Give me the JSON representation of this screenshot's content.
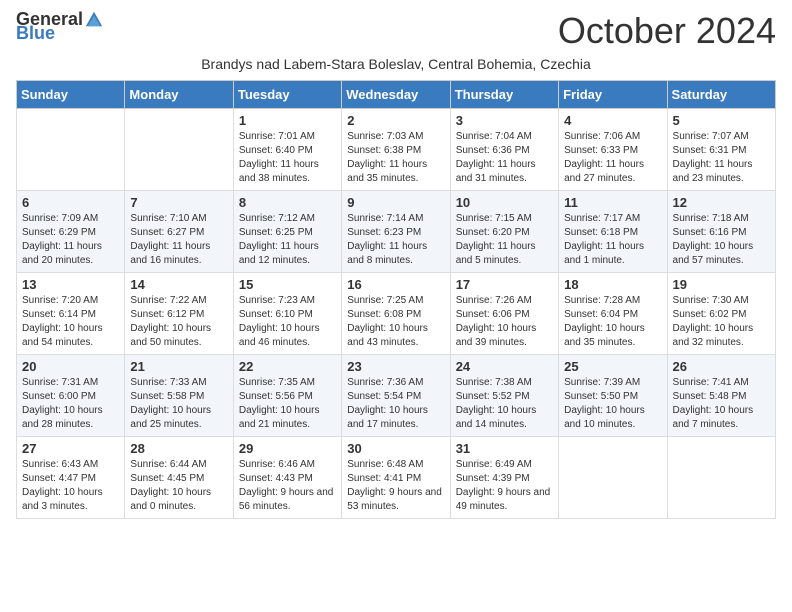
{
  "header": {
    "logo_general": "General",
    "logo_blue": "Blue",
    "month_title": "October 2024",
    "subtitle": "Brandys nad Labem-Stara Boleslav, Central Bohemia, Czechia"
  },
  "days_of_week": [
    "Sunday",
    "Monday",
    "Tuesday",
    "Wednesday",
    "Thursday",
    "Friday",
    "Saturday"
  ],
  "weeks": [
    [
      {
        "day": "",
        "info": ""
      },
      {
        "day": "",
        "info": ""
      },
      {
        "day": "1",
        "info": "Sunrise: 7:01 AM\nSunset: 6:40 PM\nDaylight: 11 hours and 38 minutes."
      },
      {
        "day": "2",
        "info": "Sunrise: 7:03 AM\nSunset: 6:38 PM\nDaylight: 11 hours and 35 minutes."
      },
      {
        "day": "3",
        "info": "Sunrise: 7:04 AM\nSunset: 6:36 PM\nDaylight: 11 hours and 31 minutes."
      },
      {
        "day": "4",
        "info": "Sunrise: 7:06 AM\nSunset: 6:33 PM\nDaylight: 11 hours and 27 minutes."
      },
      {
        "day": "5",
        "info": "Sunrise: 7:07 AM\nSunset: 6:31 PM\nDaylight: 11 hours and 23 minutes."
      }
    ],
    [
      {
        "day": "6",
        "info": "Sunrise: 7:09 AM\nSunset: 6:29 PM\nDaylight: 11 hours and 20 minutes."
      },
      {
        "day": "7",
        "info": "Sunrise: 7:10 AM\nSunset: 6:27 PM\nDaylight: 11 hours and 16 minutes."
      },
      {
        "day": "8",
        "info": "Sunrise: 7:12 AM\nSunset: 6:25 PM\nDaylight: 11 hours and 12 minutes."
      },
      {
        "day": "9",
        "info": "Sunrise: 7:14 AM\nSunset: 6:23 PM\nDaylight: 11 hours and 8 minutes."
      },
      {
        "day": "10",
        "info": "Sunrise: 7:15 AM\nSunset: 6:20 PM\nDaylight: 11 hours and 5 minutes."
      },
      {
        "day": "11",
        "info": "Sunrise: 7:17 AM\nSunset: 6:18 PM\nDaylight: 11 hours and 1 minute."
      },
      {
        "day": "12",
        "info": "Sunrise: 7:18 AM\nSunset: 6:16 PM\nDaylight: 10 hours and 57 minutes."
      }
    ],
    [
      {
        "day": "13",
        "info": "Sunrise: 7:20 AM\nSunset: 6:14 PM\nDaylight: 10 hours and 54 minutes."
      },
      {
        "day": "14",
        "info": "Sunrise: 7:22 AM\nSunset: 6:12 PM\nDaylight: 10 hours and 50 minutes."
      },
      {
        "day": "15",
        "info": "Sunrise: 7:23 AM\nSunset: 6:10 PM\nDaylight: 10 hours and 46 minutes."
      },
      {
        "day": "16",
        "info": "Sunrise: 7:25 AM\nSunset: 6:08 PM\nDaylight: 10 hours and 43 minutes."
      },
      {
        "day": "17",
        "info": "Sunrise: 7:26 AM\nSunset: 6:06 PM\nDaylight: 10 hours and 39 minutes."
      },
      {
        "day": "18",
        "info": "Sunrise: 7:28 AM\nSunset: 6:04 PM\nDaylight: 10 hours and 35 minutes."
      },
      {
        "day": "19",
        "info": "Sunrise: 7:30 AM\nSunset: 6:02 PM\nDaylight: 10 hours and 32 minutes."
      }
    ],
    [
      {
        "day": "20",
        "info": "Sunrise: 7:31 AM\nSunset: 6:00 PM\nDaylight: 10 hours and 28 minutes."
      },
      {
        "day": "21",
        "info": "Sunrise: 7:33 AM\nSunset: 5:58 PM\nDaylight: 10 hours and 25 minutes."
      },
      {
        "day": "22",
        "info": "Sunrise: 7:35 AM\nSunset: 5:56 PM\nDaylight: 10 hours and 21 minutes."
      },
      {
        "day": "23",
        "info": "Sunrise: 7:36 AM\nSunset: 5:54 PM\nDaylight: 10 hours and 17 minutes."
      },
      {
        "day": "24",
        "info": "Sunrise: 7:38 AM\nSunset: 5:52 PM\nDaylight: 10 hours and 14 minutes."
      },
      {
        "day": "25",
        "info": "Sunrise: 7:39 AM\nSunset: 5:50 PM\nDaylight: 10 hours and 10 minutes."
      },
      {
        "day": "26",
        "info": "Sunrise: 7:41 AM\nSunset: 5:48 PM\nDaylight: 10 hours and 7 minutes."
      }
    ],
    [
      {
        "day": "27",
        "info": "Sunrise: 6:43 AM\nSunset: 4:47 PM\nDaylight: 10 hours and 3 minutes."
      },
      {
        "day": "28",
        "info": "Sunrise: 6:44 AM\nSunset: 4:45 PM\nDaylight: 10 hours and 0 minutes."
      },
      {
        "day": "29",
        "info": "Sunrise: 6:46 AM\nSunset: 4:43 PM\nDaylight: 9 hours and 56 minutes."
      },
      {
        "day": "30",
        "info": "Sunrise: 6:48 AM\nSunset: 4:41 PM\nDaylight: 9 hours and 53 minutes."
      },
      {
        "day": "31",
        "info": "Sunrise: 6:49 AM\nSunset: 4:39 PM\nDaylight: 9 hours and 49 minutes."
      },
      {
        "day": "",
        "info": ""
      },
      {
        "day": "",
        "info": ""
      }
    ]
  ]
}
